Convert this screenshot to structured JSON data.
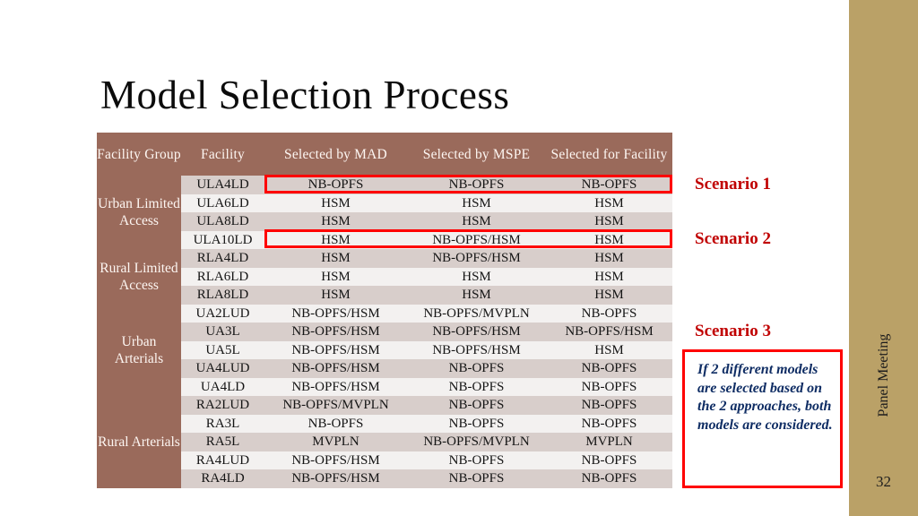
{
  "slide": {
    "title": "Model Selection Process",
    "number": "32",
    "side_band_text": "Panel Meeting",
    "side_band_color": "#baa167"
  },
  "table": {
    "header_bg": "#9a6a5b",
    "header_text_color": "#fdf6f2",
    "row_band_dark": "#d8cecb",
    "row_band_light": "#f3f1f0",
    "columns": [
      "Facility Group",
      "Facility",
      "Selected by MAD",
      "Selected by MSPE",
      "Selected for Facility"
    ],
    "groups": [
      {
        "name": "Urban Limited Access",
        "rows": [
          {
            "facility": "ULA4LD",
            "mad": "NB-OPFS",
            "mspe": "NB-OPFS",
            "selected": "NB-OPFS"
          },
          {
            "facility": "ULA6LD",
            "mad": "HSM",
            "mspe": "HSM",
            "selected": "HSM"
          },
          {
            "facility": "ULA8LD",
            "mad": "HSM",
            "mspe": "HSM",
            "selected": "HSM"
          },
          {
            "facility": "ULA10LD",
            "mad": "HSM",
            "mspe": "NB-OPFS/HSM",
            "selected": "HSM"
          }
        ]
      },
      {
        "name": "Rural Limited Access",
        "rows": [
          {
            "facility": "RLA4LD",
            "mad": "HSM",
            "mspe": "NB-OPFS/HSM",
            "selected": "HSM"
          },
          {
            "facility": "RLA6LD",
            "mad": "HSM",
            "mspe": "HSM",
            "selected": "HSM"
          },
          {
            "facility": "RLA8LD",
            "mad": "HSM",
            "mspe": "HSM",
            "selected": "HSM"
          }
        ]
      },
      {
        "name": "Urban Arterials",
        "rows": [
          {
            "facility": "UA2LUD",
            "mad": "NB-OPFS/HSM",
            "mspe": "NB-OPFS/MVPLN",
            "selected": "NB-OPFS"
          },
          {
            "facility": "UA3L",
            "mad": "NB-OPFS/HSM",
            "mspe": "NB-OPFS/HSM",
            "selected": "NB-OPFS/HSM"
          },
          {
            "facility": "UA5L",
            "mad": "NB-OPFS/HSM",
            "mspe": "NB-OPFS/HSM",
            "selected": "HSM"
          },
          {
            "facility": "UA4LUD",
            "mad": "NB-OPFS/HSM",
            "mspe": "NB-OPFS",
            "selected": "NB-OPFS"
          },
          {
            "facility": "UA4LD",
            "mad": "NB-OPFS/HSM",
            "mspe": "NB-OPFS",
            "selected": "NB-OPFS"
          }
        ]
      },
      {
        "name": "Rural Arterials",
        "rows": [
          {
            "facility": "RA2LUD",
            "mad": "NB-OPFS/MVPLN",
            "mspe": "NB-OPFS",
            "selected": "NB-OPFS"
          },
          {
            "facility": "RA3L",
            "mad": "NB-OPFS",
            "mspe": "NB-OPFS",
            "selected": "NB-OPFS"
          },
          {
            "facility": "RA5L",
            "mad": "MVPLN",
            "mspe": "NB-OPFS/MVPLN",
            "selected": "MVPLN"
          },
          {
            "facility": "RA4LUD",
            "mad": "NB-OPFS/HSM",
            "mspe": "NB-OPFS",
            "selected": "NB-OPFS"
          },
          {
            "facility": "RA4LD",
            "mad": "NB-OPFS/HSM",
            "mspe": "NB-OPFS",
            "selected": "NB-OPFS"
          }
        ]
      }
    ]
  },
  "annotations": {
    "highlight_color": "#ff0000",
    "scenario_label_color": "#c00000",
    "scenario_1": "Scenario 1",
    "scenario_2": "Scenario 2",
    "scenario_3": "Scenario 3",
    "note": "If 2 different models are selected based on the 2 approaches, both models are considered.",
    "note_text_color": "#0f2d64"
  }
}
